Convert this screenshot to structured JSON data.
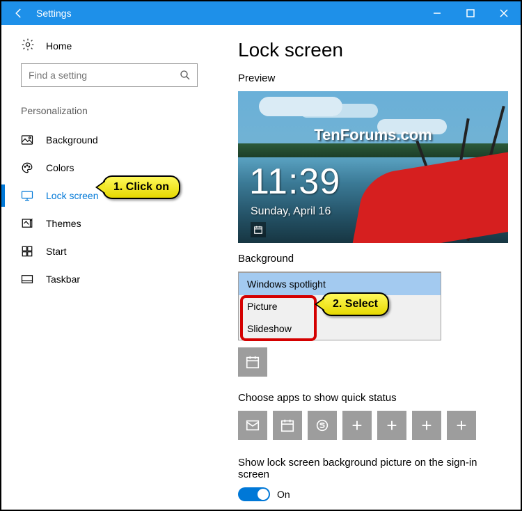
{
  "titlebar": {
    "title": "Settings"
  },
  "sidebar": {
    "home": "Home",
    "search_placeholder": "Find a setting",
    "section": "Personalization",
    "items": [
      {
        "label": "Background"
      },
      {
        "label": "Colors"
      },
      {
        "label": "Lock screen"
      },
      {
        "label": "Themes"
      },
      {
        "label": "Start"
      },
      {
        "label": "Taskbar"
      }
    ]
  },
  "main": {
    "heading": "Lock screen",
    "preview_label": "Preview",
    "watermark": "TenForums.com",
    "time": "11:39",
    "date": "Sunday, April 16",
    "bg_label": "Background",
    "bg_options": [
      "Windows spotlight",
      "Picture",
      "Slideshow"
    ],
    "quick_status_label": "Choose apps to show quick status",
    "signin_label": "Show lock screen background picture on the sign-in screen",
    "toggle_state": "On"
  },
  "callouts": {
    "c1": "1. Click on",
    "c2": "2. Select"
  }
}
